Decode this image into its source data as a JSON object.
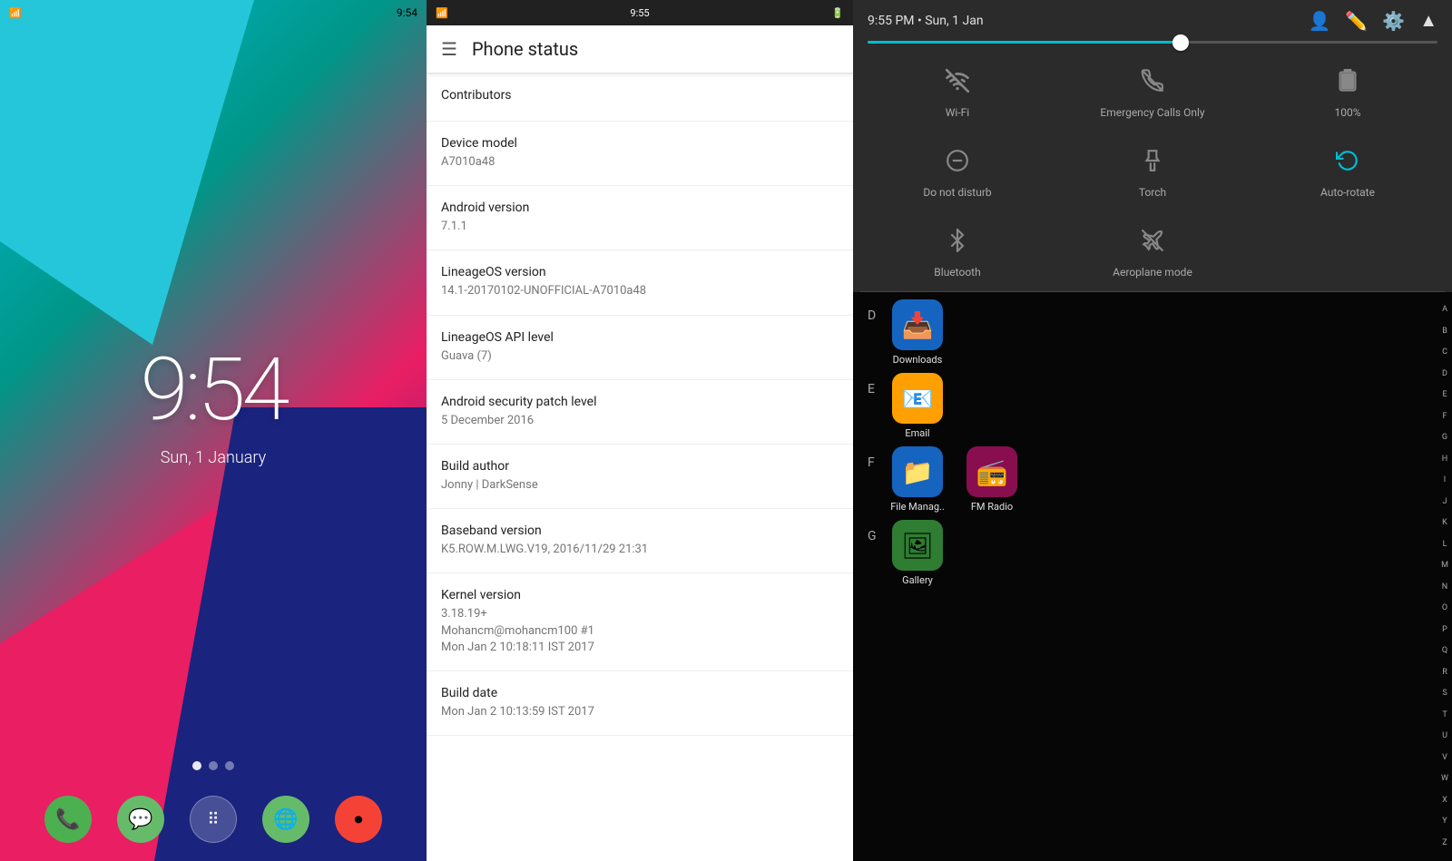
{
  "lock_screen": {
    "time": "9:54",
    "date": "Sun, 1 January",
    "status_bar": {
      "time": "9:54"
    }
  },
  "phone_status": {
    "title": "Phone status",
    "status_bar_time": "9:55",
    "menu_icon": "☰",
    "items": [
      {
        "label": "Contributors",
        "value": ""
      },
      {
        "label": "Device model",
        "value": "A7010a48"
      },
      {
        "label": "Android version",
        "value": "7.1.1"
      },
      {
        "label": "LineageOS version",
        "value": "14.1-20170102-UNOFFICIAL-A7010a48"
      },
      {
        "label": "LineageOS API level",
        "value": "Guava (7)"
      },
      {
        "label": "Android security patch level",
        "value": "5 December 2016"
      },
      {
        "label": "Build author",
        "value": "Jonny | DarkSense"
      },
      {
        "label": "Baseband version",
        "value": "K5.ROW.M.LWG.V19, 2016/11/29 21:31"
      },
      {
        "label": "Kernel version",
        "value": "3.18.19+\nMohancm@mohancm100 #1\nMon Jan 2 10:18:11 IST 2017"
      },
      {
        "label": "Build date",
        "value": "Mon Jan 2 10:13:59 IST 2017"
      }
    ]
  },
  "quick_settings": {
    "header": {
      "time_date": "9:55 PM • Sun, 1 Jan"
    },
    "brightness": {
      "fill_percent": 55
    },
    "tiles": [
      {
        "id": "wifi",
        "label": "Wi-Fi",
        "icon": "wifi_off",
        "active": false
      },
      {
        "id": "emergency",
        "label": "Emergency Calls Only",
        "icon": "phone_disabled",
        "active": false
      },
      {
        "id": "battery",
        "label": "100%",
        "icon": "battery_full",
        "active": false
      },
      {
        "id": "dnd",
        "label": "Do not disturb",
        "icon": "do_not_disturb",
        "active": false
      },
      {
        "id": "torch",
        "label": "Torch",
        "icon": "flashlight",
        "active": false
      },
      {
        "id": "autorotate",
        "label": "Auto-rotate",
        "icon": "screen_rotation",
        "active": true
      },
      {
        "id": "bluetooth",
        "label": "Bluetooth",
        "icon": "bluetooth",
        "active": false
      },
      {
        "id": "aeroplane",
        "label": "Aeroplane mode",
        "icon": "airplanemode_inactive",
        "active": false
      }
    ],
    "app_sections": [
      {
        "letter": "D",
        "apps": [
          {
            "name": "Downloads",
            "icon_class": "app-icon-downloads",
            "emoji": "📥"
          }
        ]
      },
      {
        "letter": "E",
        "apps": [
          {
            "name": "Email",
            "icon_class": "app-icon-email",
            "emoji": "📧"
          }
        ]
      },
      {
        "letter": "F",
        "apps": [
          {
            "name": "File Manag..",
            "icon_class": "app-icon-filemanager",
            "emoji": "📁"
          },
          {
            "name": "FM Radio",
            "icon_class": "app-icon-fmradio",
            "emoji": "📻"
          }
        ]
      },
      {
        "letter": "G",
        "apps": [
          {
            "name": "Gallery",
            "icon_class": "app-icon-gallery",
            "emoji": "🖼"
          }
        ]
      }
    ],
    "alpha_bar": [
      "A",
      "B",
      "C",
      "D",
      "E",
      "F",
      "G",
      "H",
      "I",
      "J",
      "K",
      "L",
      "M",
      "N",
      "O",
      "P",
      "Q",
      "R",
      "S",
      "T",
      "U",
      "V",
      "W",
      "X",
      "Y",
      "Z"
    ]
  },
  "dock": {
    "apps": [
      {
        "name": "Phone",
        "emoji": "📞",
        "class": "dock-phone"
      },
      {
        "name": "Messages",
        "emoji": "💬",
        "class": "dock-msg"
      },
      {
        "name": "Apps",
        "emoji": "⠿",
        "class": "dock-apps"
      },
      {
        "name": "Browser",
        "emoji": "🌐",
        "class": "dock-browser"
      },
      {
        "name": "Record",
        "emoji": "⏺",
        "class": "dock-rec"
      }
    ]
  }
}
